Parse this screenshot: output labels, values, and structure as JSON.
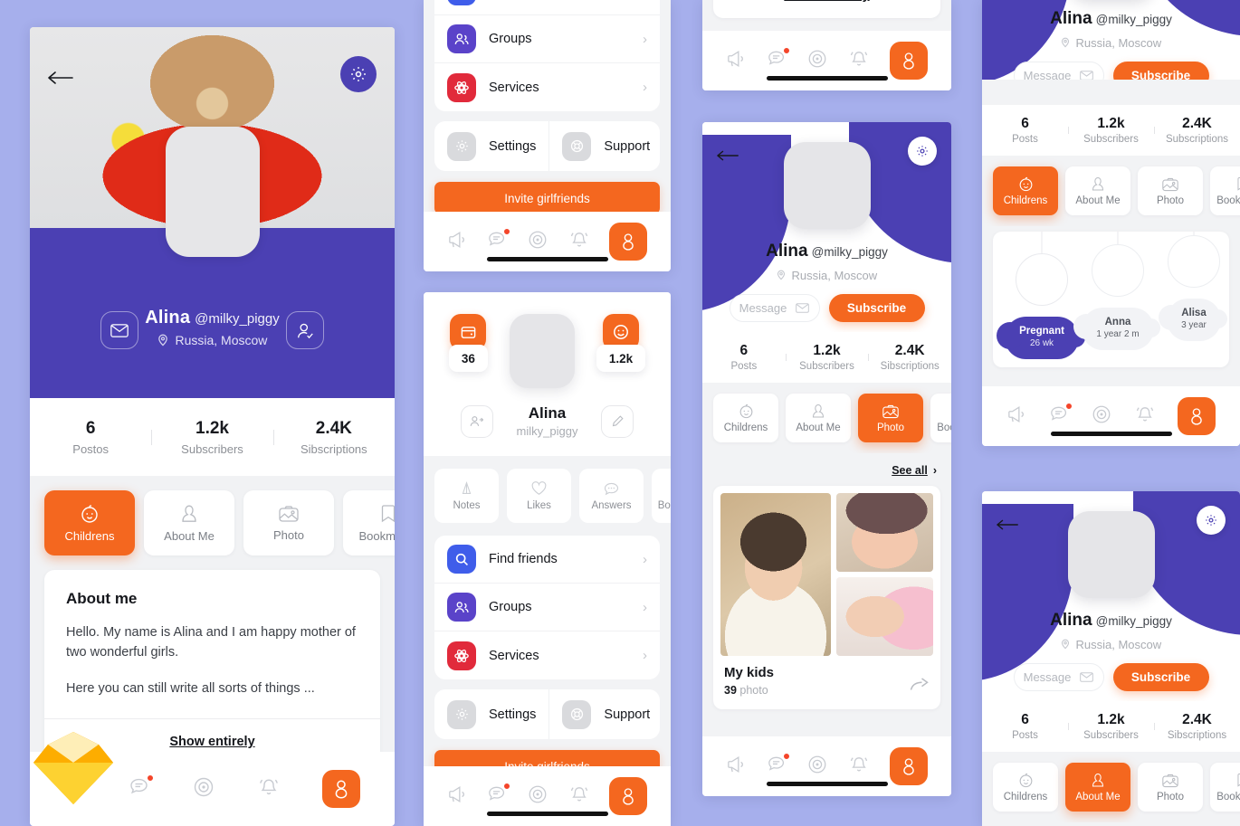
{
  "theme": {
    "background": "#a6afec",
    "purple": "#4b40b3",
    "orange": "#f4671f",
    "card": "#ffffff",
    "panel_bg": "#f1f2f4",
    "muted_text": "#8d9096"
  },
  "profile": {
    "name": "Alina",
    "handle": "@milky_piggy",
    "handle_plain": "milky_piggy",
    "location": "Russia, Moscow"
  },
  "stats_main": [
    {
      "value": "6",
      "label": "Postos"
    },
    {
      "value": "1.2k",
      "label": "Subscribers"
    },
    {
      "value": "2.4K",
      "label": "Sibscriptions"
    }
  ],
  "stats_alt": [
    {
      "value": "6",
      "label": "Posts"
    },
    {
      "value": "1.2k",
      "label": "Subscribers"
    },
    {
      "value": "2.4K",
      "label": "Sibscriptions"
    }
  ],
  "stats_alt2": [
    {
      "value": "6",
      "label": "Posts"
    },
    {
      "value": "1.2k",
      "label": "Subscribers"
    },
    {
      "value": "2.4K",
      "label": "Subscriptions"
    }
  ],
  "tabs": [
    {
      "label": "Childrens",
      "icon": "baby-face-icon"
    },
    {
      "label": "About Me",
      "icon": "person-portrait-icon"
    },
    {
      "label": "Photo",
      "icon": "photo-icon"
    },
    {
      "label": "Bookmarks",
      "icon": "bookmark-icon"
    }
  ],
  "about": {
    "heading": "About me",
    "paragraph1": "Hello. My name is Alina and I am happy mother of two wonderful girls.",
    "paragraph2": "Here you can still write all sorts of things ...",
    "show_entirely": "Show entirely"
  },
  "actions": {
    "message": "Message",
    "subscribe": "Subscribe",
    "invite": "Invite girlfriends",
    "see_all": "See all"
  },
  "menu": {
    "items": [
      {
        "label": "Find friends",
        "icon": "search-icon",
        "color": "blue"
      },
      {
        "label": "Groups",
        "icon": "people-icon",
        "color": "purple"
      },
      {
        "label": "Services",
        "icon": "atom-icon",
        "color": "red"
      }
    ],
    "secondary": [
      {
        "label": "Settings",
        "icon": "gear-icon"
      },
      {
        "label": "Support",
        "icon": "lifebuoy-icon"
      }
    ]
  },
  "counters": {
    "left": {
      "value": "36",
      "icon": "wallet-icon"
    },
    "right": {
      "value": "1.2k",
      "icon": "smiley-icon"
    }
  },
  "quick_tiles": [
    {
      "label": "Notes",
      "icon": "note-icon"
    },
    {
      "label": "Likes",
      "icon": "heart-icon"
    },
    {
      "label": "Answers",
      "icon": "comment-dots-icon"
    },
    {
      "label": "Bookmarks",
      "icon": "bookmark-icon"
    }
  ],
  "gallery": {
    "title": "My kids",
    "count": "39",
    "count_suffix": "photo"
  },
  "children": [
    {
      "name": "Pregnant",
      "age": "26 wk",
      "selected": true
    },
    {
      "name": "Anna",
      "age": "1 year 2 m",
      "selected": false
    },
    {
      "name": "Alisa",
      "age": "3 year",
      "selected": false
    }
  ],
  "nav": [
    {
      "icon": "megaphone-icon",
      "badge": false
    },
    {
      "icon": "chat-icon",
      "badge": true
    },
    {
      "icon": "target-icon",
      "badge": false
    },
    {
      "icon": "bell-icon",
      "badge": false
    },
    {
      "icon": "profile-icon",
      "badge": false,
      "active": true
    }
  ],
  "icons": {
    "back": "arrow-left-icon",
    "gear": "gear-icon",
    "mail": "mail-icon",
    "add_friend": "add-friend-icon",
    "edit": "pencil-icon",
    "share": "share-icon",
    "location": "location-pin-icon"
  }
}
